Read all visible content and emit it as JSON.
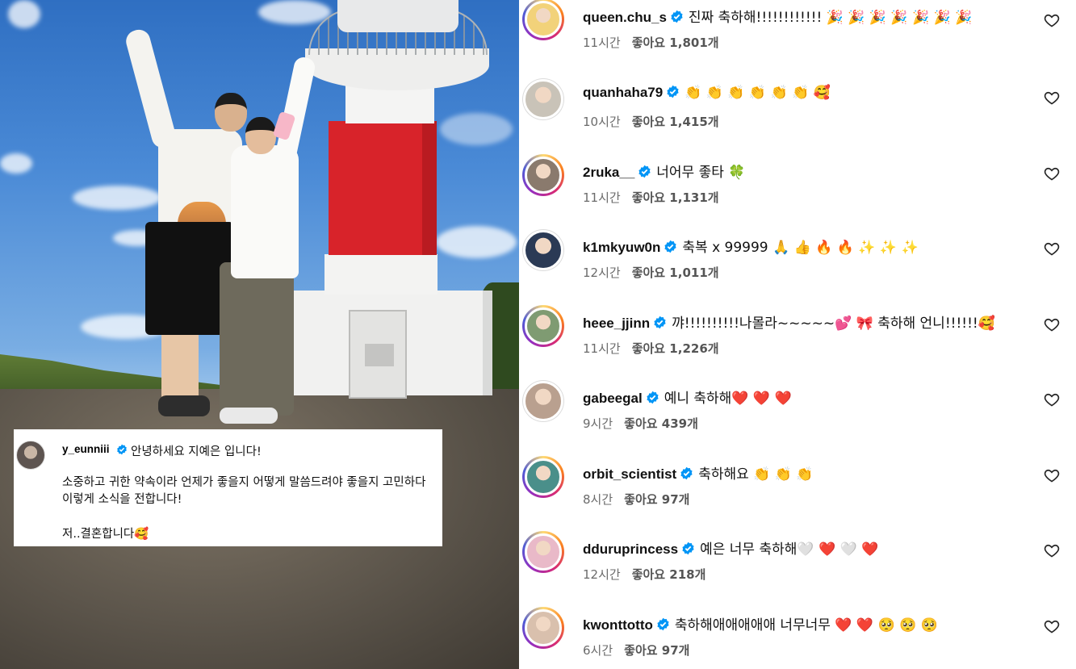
{
  "caption": {
    "username": "y_eunniii",
    "verified_icon": "verified-badge-icon",
    "first_line": "안녕하세요 지예은 입니다!",
    "body": "소중하고 귀한 약속이라 언제가 좋을지 어떻게 말씀드려야 좋을지 고민하다 이렇게 소식을 전합니다!",
    "last_line": "저..결혼합니다🥰"
  },
  "comments": [
    {
      "username": "queen.chu_s",
      "text": "진짜 축하해!!!!!!!!!!!! 🎉 🎉 🎉 🎉 🎉 🎉 🎉",
      "time": "11시간",
      "likes": "좋아요 1,801개",
      "avatar_color": "#f2d27a",
      "ring": true
    },
    {
      "username": "quanhaha79",
      "text": "👏 👏 👏 👏 👏 👏 🥰",
      "time": "10시간",
      "likes": "좋아요 1,415개",
      "avatar_color": "#c9c3b8",
      "ring": false
    },
    {
      "username": "2ruka__",
      "text": "너어무 좋타 🍀",
      "time": "11시간",
      "likes": "좋아요 1,131개",
      "avatar_color": "#8a7a6d",
      "ring": true
    },
    {
      "username": "k1mkyuw0n",
      "text": "축복 x 99999 🙏 👍 🔥 🔥 ✨ ✨ ✨",
      "time": "12시간",
      "likes": "좋아요 1,011개",
      "avatar_color": "#2b3a55",
      "ring": false
    },
    {
      "username": "heee_jjinn",
      "text": "꺄!!!!!!!!!!나몰라~~~~~💕 🎀 축하해 언니!!!!!!🥰",
      "time": "11시간",
      "likes": "좋아요 1,226개",
      "avatar_color": "#7f9b72",
      "ring": true
    },
    {
      "username": "gabeegal",
      "text": "예니 축하해❤️ ❤️ ❤️",
      "time": "9시간",
      "likes": "좋아요 439개",
      "avatar_color": "#b9a08f",
      "ring": false
    },
    {
      "username": "orbit_scientist",
      "text": "축하해요 👏 👏 👏",
      "time": "8시간",
      "likes": "좋아요 97개",
      "avatar_color": "#4a8f8a",
      "ring": true
    },
    {
      "username": "dduruprincess",
      "text": "예은 너무 축하해🤍 ❤️ 🤍 ❤️",
      "time": "12시간",
      "likes": "좋아요 218개",
      "avatar_color": "#e9b9c8",
      "ring": true
    },
    {
      "username": "kwonttotto",
      "text": "축하해애애애애애 너무너무 ❤️ ❤️ 🥺 🥺 🥺",
      "time": "6시간",
      "likes": "좋아요 97개",
      "avatar_color": "#d9c0ad",
      "ring": true
    }
  ],
  "icons": {
    "like": "heart-outline-icon",
    "verified": "verified-badge-icon"
  },
  "colors": {
    "verified_blue": "#0095f6",
    "text": "#111111",
    "meta": "#6b6b6b"
  }
}
